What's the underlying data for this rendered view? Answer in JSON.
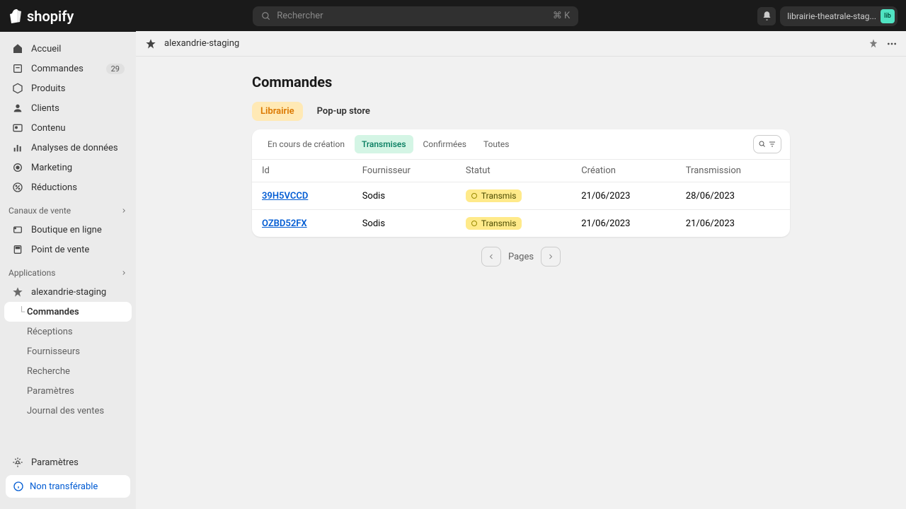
{
  "topbar": {
    "logo_text": "shopify",
    "search_placeholder": "Rechercher",
    "shortcut": "⌘ K",
    "store_name": "librairie-theatrale-stag...",
    "store_initials": "lib"
  },
  "sidebar": {
    "main": [
      {
        "icon": "home",
        "label": "Accueil"
      },
      {
        "icon": "orders",
        "label": "Commandes",
        "badge": "29"
      },
      {
        "icon": "products",
        "label": "Produits"
      },
      {
        "icon": "customers",
        "label": "Clients"
      },
      {
        "icon": "content",
        "label": "Contenu"
      },
      {
        "icon": "analytics",
        "label": "Analyses de données"
      },
      {
        "icon": "marketing",
        "label": "Marketing"
      },
      {
        "icon": "discounts",
        "label": "Réductions"
      }
    ],
    "channels_header": "Canaux de vente",
    "channels": [
      {
        "icon": "online",
        "label": "Boutique en ligne"
      },
      {
        "icon": "pos",
        "label": "Point de vente"
      }
    ],
    "apps_header": "Applications",
    "apps": [
      {
        "icon": "app",
        "label": "alexandrie-staging"
      }
    ],
    "app_sub": [
      {
        "label": "Commandes",
        "active": true
      },
      {
        "label": "Réceptions"
      },
      {
        "label": "Fournisseurs"
      },
      {
        "label": "Recherche"
      },
      {
        "label": "Paramètres"
      },
      {
        "label": "Journal des ventes"
      }
    ],
    "settings": "Paramètres",
    "alert": "Non transférable"
  },
  "titlebar": {
    "app_name": "alexandrie-staging"
  },
  "page": {
    "title": "Commandes",
    "store_tabs": [
      {
        "label": "Librairie",
        "active": true
      },
      {
        "label": "Pop-up store"
      }
    ],
    "filter_tabs": [
      {
        "label": "En cours de création"
      },
      {
        "label": "Transmises",
        "active": true
      },
      {
        "label": "Confirmées"
      },
      {
        "label": "Toutes"
      }
    ],
    "columns": [
      "Id",
      "Fournisseur",
      "Statut",
      "Création",
      "Transmission"
    ],
    "rows": [
      {
        "id": "39H5VCCD",
        "supplier": "Sodis",
        "status": "Transmis",
        "created": "21/06/2023",
        "transmitted": "28/06/2023"
      },
      {
        "id": "OZBD52FX",
        "supplier": "Sodis",
        "status": "Transmis",
        "created": "21/06/2023",
        "transmitted": "21/06/2023"
      }
    ],
    "pagination_label": "Pages"
  }
}
